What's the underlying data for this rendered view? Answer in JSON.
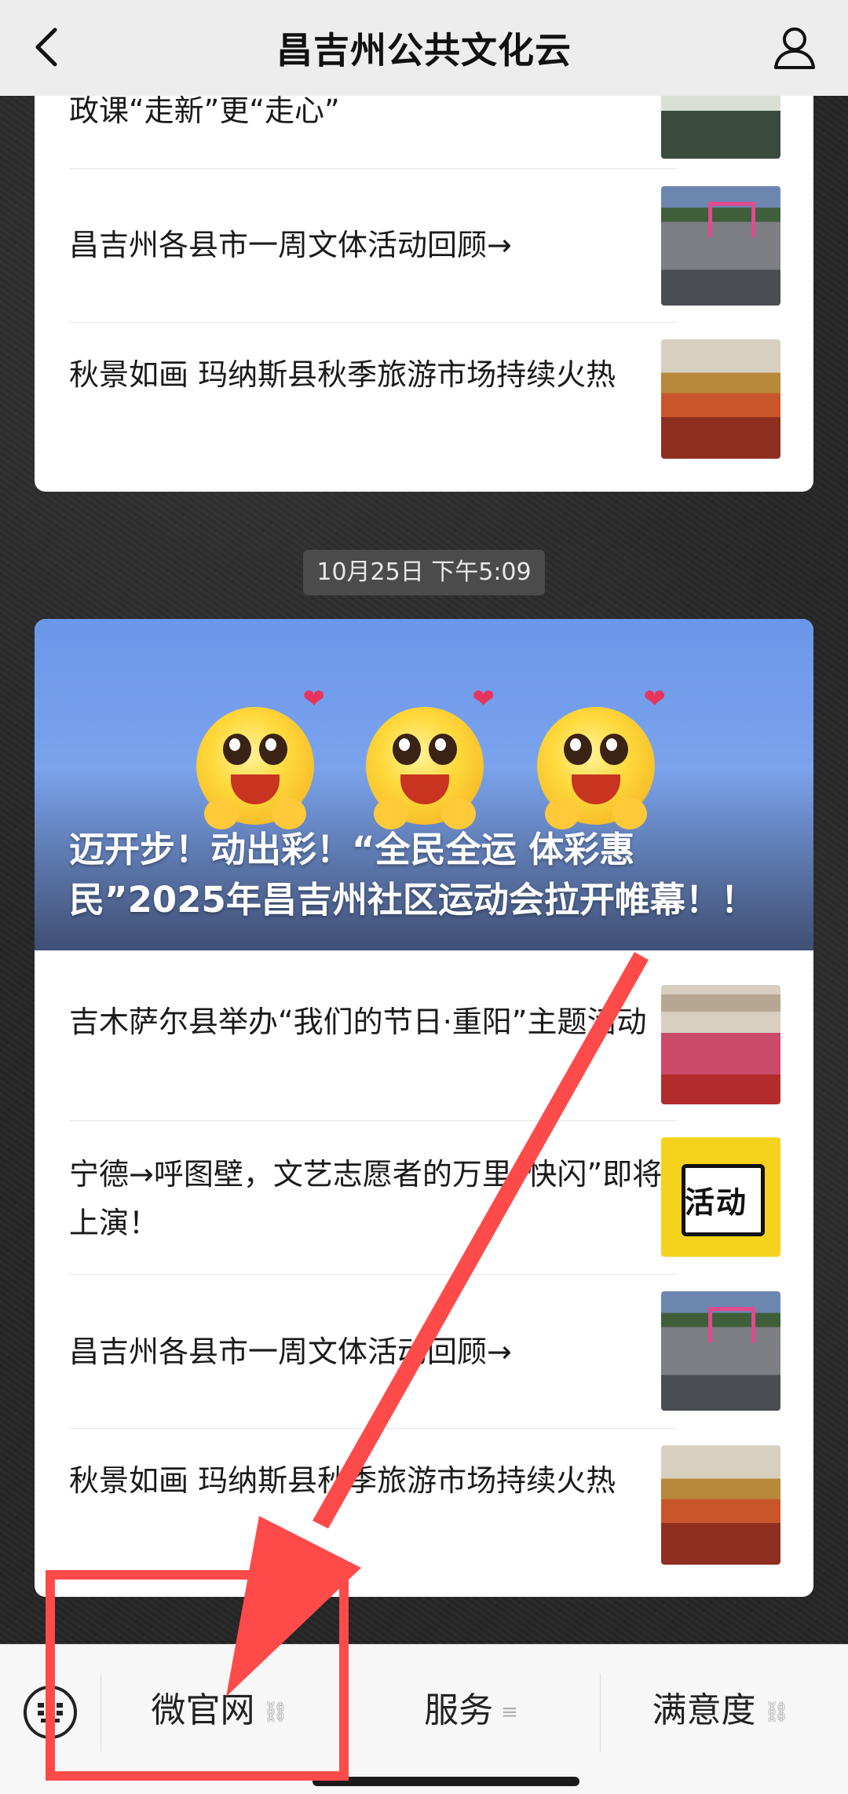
{
  "header": {
    "title": "昌吉州公共文化云"
  },
  "card1": {
    "items": [
      {
        "text": "政课“走新”更“走心”",
        "thumb": "students"
      },
      {
        "text": "昌吉州各县市一周文体活动回顾→",
        "thumb": "parade"
      },
      {
        "text": "秋景如画 玛纳斯县秋季旅游市场持续火热",
        "thumb": "autumn"
      }
    ]
  },
  "timestamp": "10月25日 下午5:09",
  "card2": {
    "banner_title": "迈开步！动出彩！“全民全运 体彩惠民”2025年昌吉州社区运动会拉开帷幕！！",
    "items": [
      {
        "text": "吉木萨尔县举办“我们的节日·重阳”主题活动",
        "thumb": "event"
      },
      {
        "text": "宁德→呼图壁，文艺志愿者的万里“快闪”即将上演！",
        "thumb": "activity",
        "thumb_label": "活动"
      },
      {
        "text": "昌吉州各县市一周文体活动回顾→",
        "thumb": "parade"
      },
      {
        "text": "秋景如画 玛纳斯县秋季旅游市场持续火热",
        "thumb": "autumn"
      }
    ]
  },
  "bottom_menu": {
    "items": [
      {
        "label": "微官网",
        "icon": "link-icon"
      },
      {
        "label": "服务",
        "icon": "menu-icon"
      },
      {
        "label": "满意度",
        "icon": "link-icon"
      }
    ]
  },
  "colors": {
    "annotation": "#ff4a4a",
    "banner": "#6b97ea"
  }
}
